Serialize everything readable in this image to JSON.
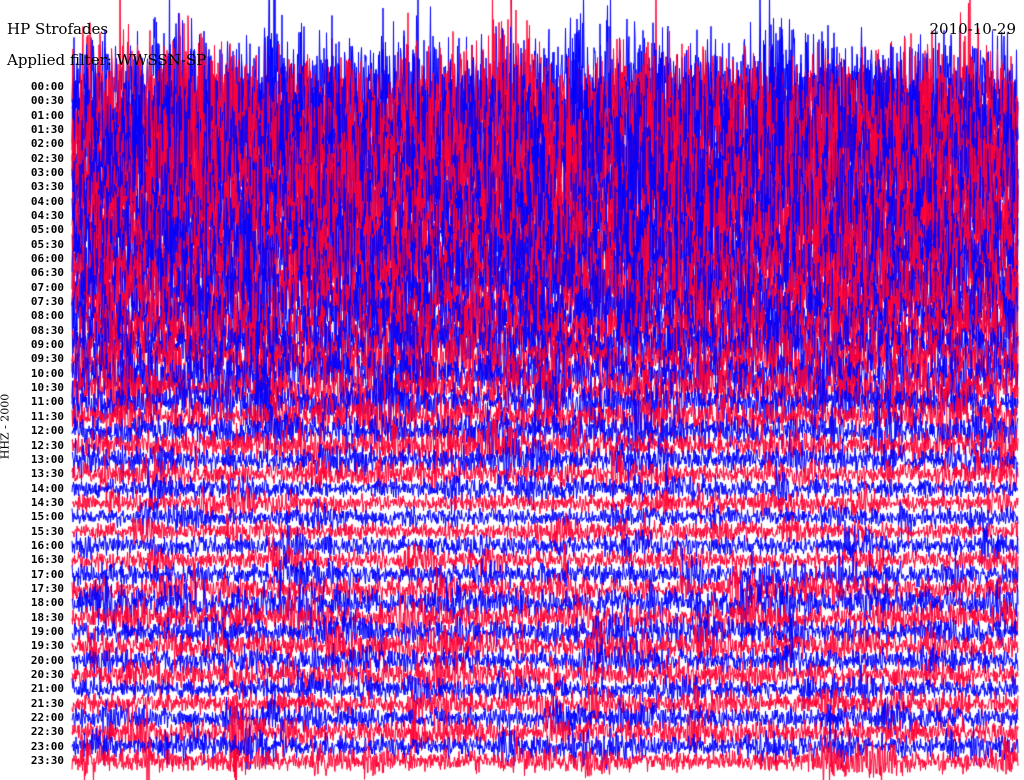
{
  "chart_data": {
    "type": "line",
    "title": "HP Strofades",
    "subtitle": "Applied filter: WWSSN-SP",
    "date": "2010-10-29",
    "ylabel": "HHZ - 2000",
    "row_labels": [
      "00:00",
      "00:30",
      "01:00",
      "01:30",
      "02:00",
      "02:30",
      "03:00",
      "03:30",
      "04:00",
      "04:30",
      "05:00",
      "05:30",
      "06:00",
      "06:30",
      "07:00",
      "07:30",
      "08:00",
      "08:30",
      "09:00",
      "09:30",
      "10:00",
      "10:30",
      "11:00",
      "11:30",
      "12:00",
      "12:30",
      "13:00",
      "13:30",
      "14:00",
      "14:30",
      "15:00",
      "15:30",
      "16:00",
      "16:30",
      "17:00",
      "17:30",
      "18:00",
      "18:30",
      "19:00",
      "19:30",
      "20:00",
      "20:30",
      "21:00",
      "21:30",
      "22:00",
      "22:30",
      "23:00",
      "23:30"
    ],
    "relative_amplitude": [
      6,
      6,
      6,
      6,
      6,
      6,
      6,
      5.5,
      5.5,
      5,
      5,
      4.5,
      4.5,
      4,
      4,
      3.8,
      3.5,
      3.2,
      3,
      2.8,
      2.5,
      2.2,
      2,
      1.8,
      1.7,
      1.5,
      1.3,
      1.2,
      1.1,
      1,
      1,
      1,
      1.1,
      1.1,
      1.3,
      1.4,
      1.5,
      1.5,
      1.4,
      1.4,
      1.3,
      1.3,
      1.2,
      1.2,
      1.2,
      1.3,
      1.2,
      1.2
    ],
    "events": [
      {
        "row": "22:30",
        "minute_offset": 5,
        "relative_amplitude": 5
      }
    ],
    "colors": [
      "#0000ff",
      "#ff0033"
    ]
  }
}
